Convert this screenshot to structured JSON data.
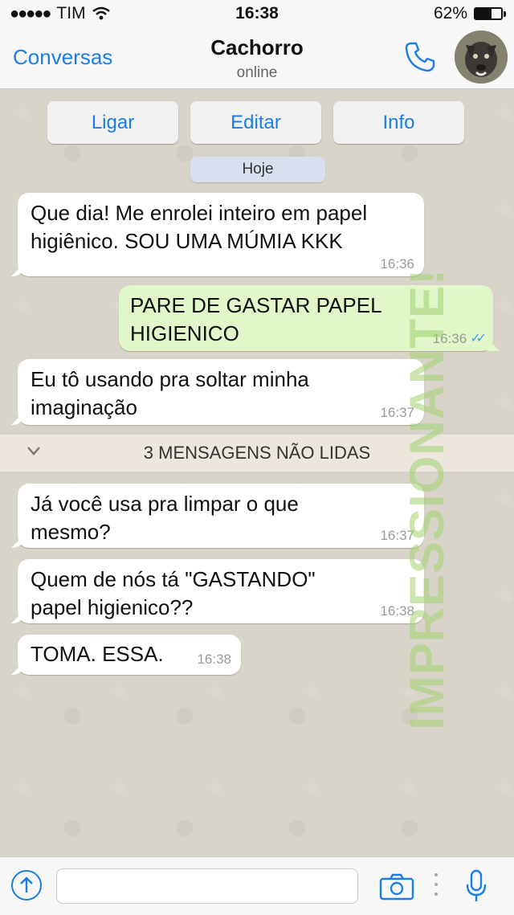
{
  "status": {
    "carrier": "TIM",
    "time": "16:38",
    "battery": "62%",
    "battery_level": 0.62
  },
  "nav": {
    "back_label": "Conversas",
    "contact_name": "Cachorro",
    "presence": "online"
  },
  "actions": [
    "Ligar",
    "Editar",
    "Info"
  ],
  "date_chip": "Hoje",
  "messages": [
    {
      "direction": "in",
      "lines": [
        "Que dia! Me enrolei inteiro em papel",
        "higiênico. SOU UMA MÚMIA KKK"
      ],
      "time": "16:36"
    },
    {
      "direction": "out",
      "lines": [
        "PARE DE GASTAR PAPEL",
        "HIGIENICO"
      ],
      "time": "16:36"
    },
    {
      "direction": "in",
      "lines": [
        "Eu tô usando pra soltar minha",
        "imaginação"
      ],
      "time": "16:37"
    },
    {
      "direction": "in",
      "lines": [
        "Já você usa pra limpar o que",
        "mesmo?"
      ],
      "time": "16:37"
    },
    {
      "direction": "in",
      "lines": [
        "Quem de nós tá \"GASTANDO\"",
        "papel higienico??"
      ],
      "time": "16:38"
    },
    {
      "direction": "in",
      "lines": [
        "TOMA. ESSA."
      ],
      "time": "16:38"
    }
  ],
  "unread_banner": "3 MENSAGENS NÃO LIDAS",
  "watermark": "IMPRESSIONANTE!",
  "colors": {
    "accent": "#1a7ee6",
    "outgoing_bubble": "#e1f7c9",
    "incoming_bubble": "#ffffff",
    "read_ticks": "#4a9be8"
  },
  "icons": [
    "signal-dots-icon",
    "wifi-icon",
    "battery-icon",
    "phone-icon",
    "upload-icon",
    "camera-icon",
    "more-icon",
    "microphone-icon",
    "chevron-down-icon"
  ],
  "input": {
    "value": "",
    "placeholder": ""
  }
}
